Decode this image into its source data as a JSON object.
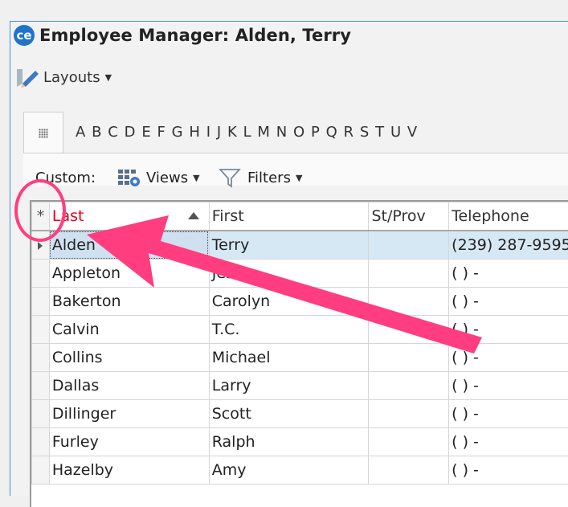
{
  "window": {
    "logo": "ce",
    "title": "Employee Manager: Alden, Terry"
  },
  "toolbar": {
    "layouts_label": "Layouts",
    "custom_label": "Custom:",
    "views_label": "Views",
    "filters_label": "Filters"
  },
  "alphabet": [
    "A",
    "B",
    "C",
    "D",
    "E",
    "F",
    "G",
    "H",
    "I",
    "J",
    "K",
    "L",
    "M",
    "N",
    "O",
    "P",
    "Q",
    "R",
    "S",
    "T",
    "U",
    "V"
  ],
  "table": {
    "headers": [
      "Last",
      "First",
      "St/Prov",
      "Telephone"
    ],
    "selector_symbol": "*",
    "rows": [
      [
        "Alden",
        "Terry",
        "",
        "(239) 287-9595"
      ],
      [
        "Appleton",
        "Jesh",
        "",
        "(  )   -"
      ],
      [
        "Bakerton",
        "Carolyn",
        "",
        "(  )   -"
      ],
      [
        "Calvin",
        "T.C.",
        "",
        "(  )   -"
      ],
      [
        "Collins",
        "Michael",
        "",
        "(  )   -"
      ],
      [
        "Dallas",
        "Larry",
        "",
        "(  )   -"
      ],
      [
        "Dillinger",
        "Scott",
        "",
        "(  )   -"
      ],
      [
        "Furley",
        "Ralph",
        "",
        "(  )   -"
      ],
      [
        "Hazelby",
        "Amy",
        "",
        "(  )   -"
      ]
    ]
  },
  "colors": {
    "accent": "#1f73c9",
    "annotation": "#ff3d7f",
    "sort_column_header": "#e0001a",
    "current_row": "#d7e8f5"
  }
}
